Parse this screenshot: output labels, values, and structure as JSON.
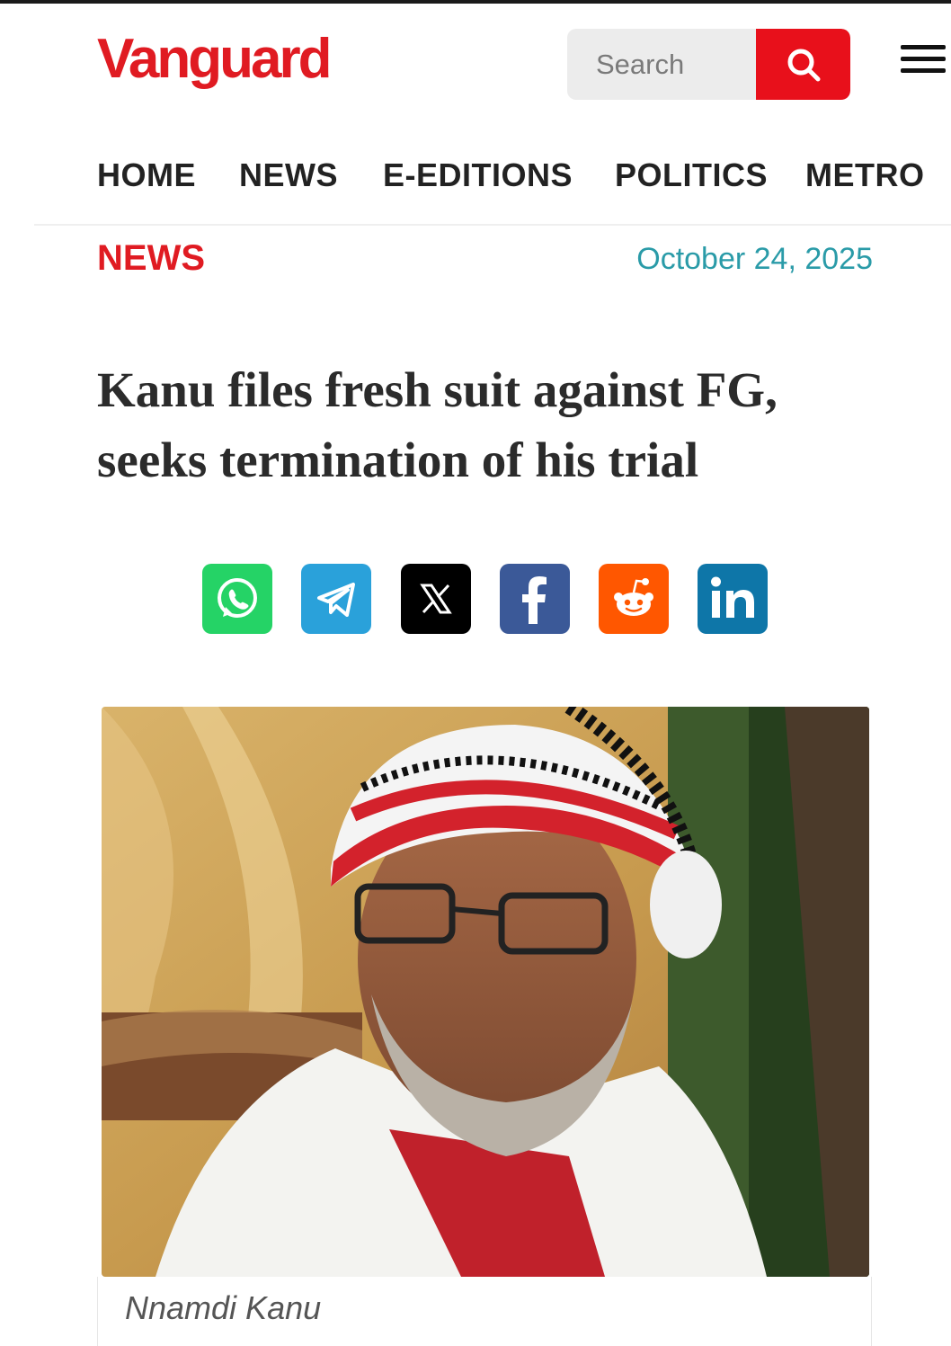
{
  "brand": {
    "name": "Vanguard",
    "color": "#e01b22"
  },
  "search": {
    "placeholder": "Search",
    "icon": "search-icon",
    "button_color": "#e8101b"
  },
  "menu": {
    "icon": "hamburger-menu-icon"
  },
  "nav": {
    "items": [
      "HOME",
      "NEWS",
      "E-EDITIONS",
      "POLITICS",
      "METRO"
    ]
  },
  "article": {
    "category": "NEWS",
    "date": "October 24, 2025",
    "headline": "Kanu files fresh suit against FG, seeks termination of his trial",
    "caption": "Nnamdi Kanu"
  },
  "share": {
    "items": [
      {
        "icon": "whatsapp-icon",
        "color": "#25d366"
      },
      {
        "icon": "telegram-icon",
        "color": "#2aa1da"
      },
      {
        "icon": "x-icon",
        "color": "#000000"
      },
      {
        "icon": "facebook-icon",
        "color": "#3b5998"
      },
      {
        "icon": "reddit-icon",
        "color": "#ff5700"
      },
      {
        "icon": "linkedin-icon",
        "color": "#0e76a8"
      }
    ]
  },
  "colors": {
    "accent": "#e01b22",
    "date": "#2a9ba8",
    "text": "#222222"
  }
}
